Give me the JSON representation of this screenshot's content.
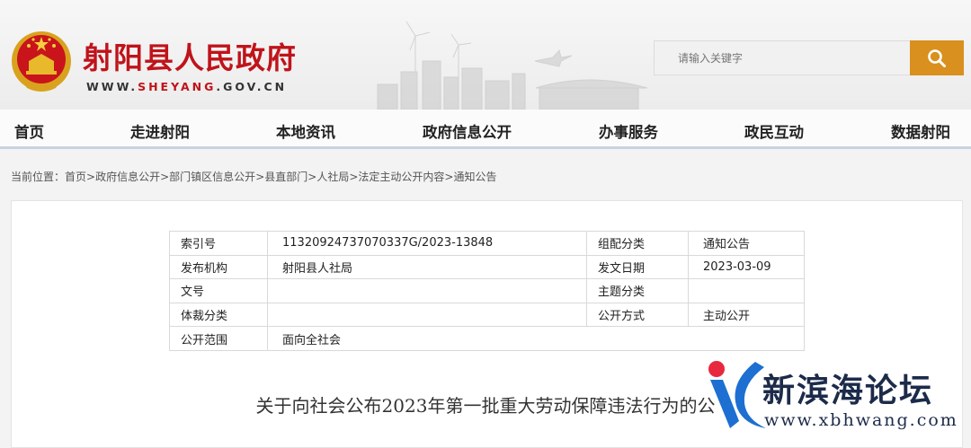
{
  "header": {
    "site_title": "射阳县人民政府",
    "domain_prefix": "WWW.",
    "domain_highlight": "SHEYANG",
    "domain_suffix": ".GOV.CN",
    "search_placeholder": "请输入关键字",
    "search_icon": "search-icon",
    "accent_color": "#c0131a",
    "search_button_color": "#d9901e"
  },
  "nav": {
    "items": [
      {
        "label": "首页"
      },
      {
        "label": "走进射阳"
      },
      {
        "label": "本地资讯"
      },
      {
        "label": "政府信息公开"
      },
      {
        "label": "办事服务"
      },
      {
        "label": "政民互动"
      },
      {
        "label": "数据射阳"
      }
    ]
  },
  "breadcrumb": {
    "prefix": "当前位置：",
    "items": [
      "首页",
      "政府信息公开",
      "部门镇区信息公开",
      "县直部门",
      "人社局",
      "法定主动公开内容",
      "通知公告"
    ],
    "separator": ">"
  },
  "meta_table": {
    "rows": [
      {
        "k1": "索引号",
        "v1": "11320924737070337G/2023-13848",
        "k2": "组配分类",
        "v2": "通知公告"
      },
      {
        "k1": "发布机构",
        "v1": "射阳县人社局",
        "k2": "发文日期",
        "v2": "2023-03-09"
      },
      {
        "k1": "文号",
        "v1": "",
        "k2": "主题分类",
        "v2": ""
      },
      {
        "k1": "体裁分类",
        "v1": "",
        "k2": "公开方式",
        "v2": "主动公开"
      },
      {
        "k1": "公开范围",
        "v1": "面向全社会"
      }
    ]
  },
  "document": {
    "title": "关于向社会公布2023年第一批重大劳动保障违法行为的公"
  },
  "watermark": {
    "text": "新滨海论坛",
    "url": "www.xbhwang.com"
  }
}
